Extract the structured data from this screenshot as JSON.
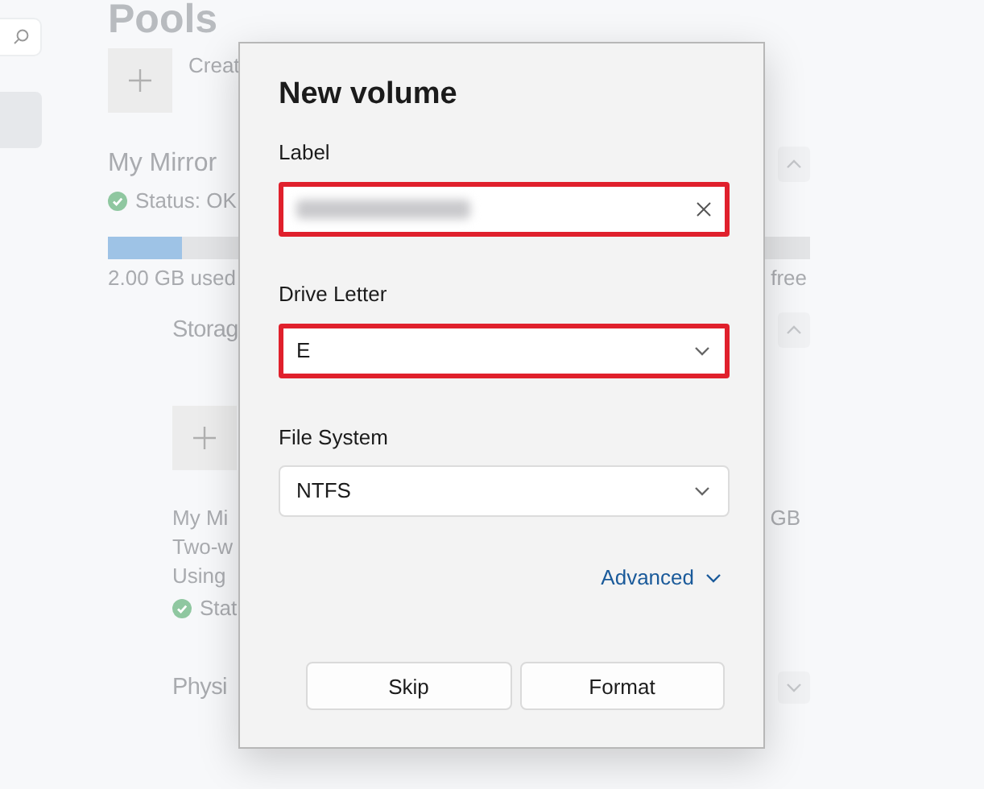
{
  "page": {
    "title": "Pools",
    "create_label": "Creat"
  },
  "pool": {
    "name": "My Mirror",
    "status": "Status: OK",
    "status_ok": true,
    "expanded": true,
    "level": 0.106,
    "used": "2.00 GB used",
    "free": "free"
  },
  "storage_spaces": {
    "title": "Storag",
    "expanded": true,
    "space": {
      "name": "My Mi",
      "size": "GB",
      "lines": [
        "Two-w",
        "Using"
      ],
      "status": "Stat",
      "status_ok": true
    }
  },
  "physical": {
    "title": "Physi",
    "expanded": false
  },
  "dialog": {
    "title": "New volume",
    "fields": [
      {
        "kind": "text",
        "label": "Label",
        "value_blurred": true,
        "highlighted": true
      },
      {
        "kind": "select",
        "label": "Drive Letter",
        "value": "E",
        "highlighted": true
      },
      {
        "kind": "select",
        "label": "File System",
        "value": "NTFS",
        "highlighted": false
      }
    ],
    "advanced": {
      "label": "Advanced",
      "expanded": false
    },
    "buttons": [
      {
        "label": "Skip"
      },
      {
        "label": "Format"
      }
    ]
  }
}
